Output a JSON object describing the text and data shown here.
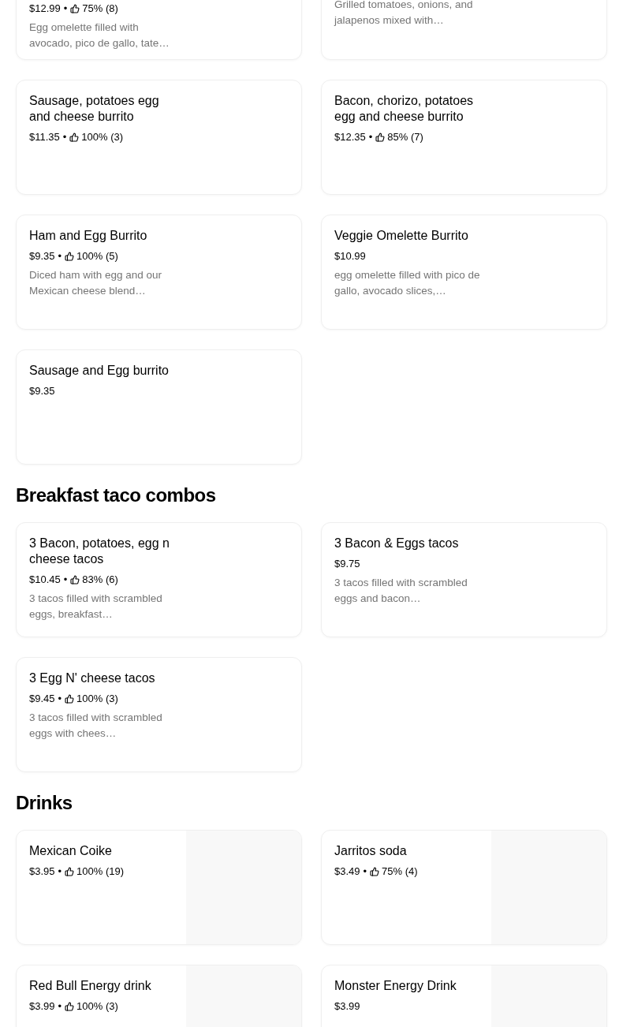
{
  "sections": [
    {
      "items": [
        {
          "price": "$12.99",
          "separator": "•",
          "rating": "75% (8)",
          "description": "Egg omelette filled with avocado, pico de gallo, tate…"
        },
        {
          "description": "Grilled tomatoes, onions, and jalapenos mixed with…"
        },
        {
          "title": "Sausage, potatoes egg and cheese burrito",
          "price": "$11.35",
          "separator": "•",
          "rating": "100% (3)"
        },
        {
          "title": "Bacon, chorizo, potatoes egg and cheese burrito",
          "price": "$12.35",
          "separator": "•",
          "rating": "85% (7)"
        },
        {
          "title": "Ham and Egg  Burrito",
          "price": "$9.35",
          "separator": "•",
          "rating": "100% (5)",
          "description": "Diced ham with egg and our Mexican cheese blend…"
        },
        {
          "title": "Veggie Omelette Burrito",
          "price": "$10.99",
          "description": "egg omelette filled with pico de gallo, avocado slices,…"
        },
        {
          "title": "Sausage and Egg burrito",
          "price": "$9.35"
        }
      ]
    },
    {
      "heading": "Breakfast taco combos",
      "items": [
        {
          "title": "3 Bacon, potatoes, egg n cheese tacos",
          "price": "$10.45",
          "separator": "•",
          "rating": "83% (6)",
          "description": "3 tacos filled with scrambled eggs, breakfast…"
        },
        {
          "title": "3 Bacon & Eggs tacos",
          "price": "$9.75",
          "description": "3 tacos filled with scrambled eggs and bacon…"
        },
        {
          "title": "3 Egg N' cheese tacos",
          "price": "$9.45",
          "separator": "•",
          "rating": "100% (3)",
          "description": "3 tacos filled with scrambled eggs with chees…"
        }
      ]
    },
    {
      "heading": "Drinks",
      "items": [
        {
          "title": "Mexican Coike",
          "price": "$3.95",
          "separator": "•",
          "rating": "100% (19)",
          "has_image": true
        },
        {
          "title": "Jarritos soda",
          "price": "$3.49",
          "separator": "•",
          "rating": "75% (4)",
          "has_image": true
        },
        {
          "title": "Red Bull Energy drink",
          "price": "$3.99",
          "separator": "•",
          "rating": "100% (3)",
          "has_image": true
        },
        {
          "title": "Monster Energy Drink",
          "price": "$3.99",
          "has_image": true
        }
      ]
    }
  ]
}
